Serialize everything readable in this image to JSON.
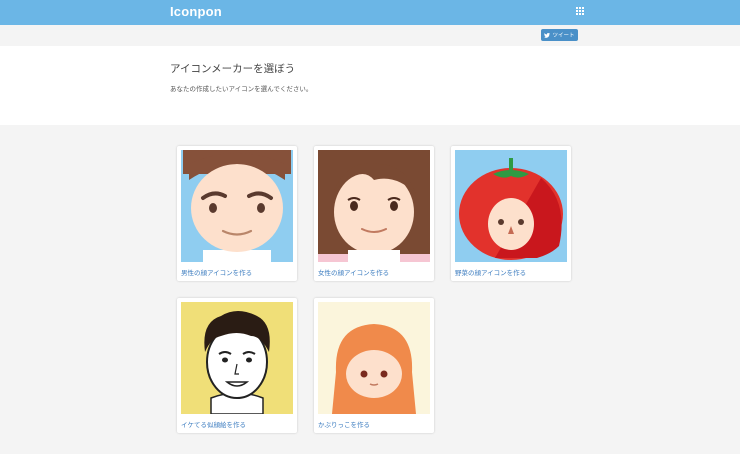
{
  "header": {
    "brand": "Iconpon",
    "menu_icon": "grid-icon"
  },
  "tweet": {
    "label": "ツイート",
    "icon": "twitter-bird-icon"
  },
  "intro": {
    "title": "アイコンメーカーを選ぼう",
    "subtitle": "あなたの作成したいアイコンを選んでください。"
  },
  "makers": [
    {
      "label": "男性の顔アイコンを作る",
      "icon": "male-face-icon"
    },
    {
      "label": "女性の顔アイコンを作る",
      "icon": "female-face-icon"
    },
    {
      "label": "野菜の顔アイコンを作る",
      "icon": "tomato-face-icon"
    },
    {
      "label": "イケてる似顔絵を作る",
      "icon": "portrait-face-icon"
    },
    {
      "label": "かぶりっこを作る",
      "icon": "hooded-kid-icon"
    }
  ],
  "colors": {
    "header": "#6bb6e6",
    "link": "#3a7bbf",
    "tweet": "#4a90c8"
  }
}
